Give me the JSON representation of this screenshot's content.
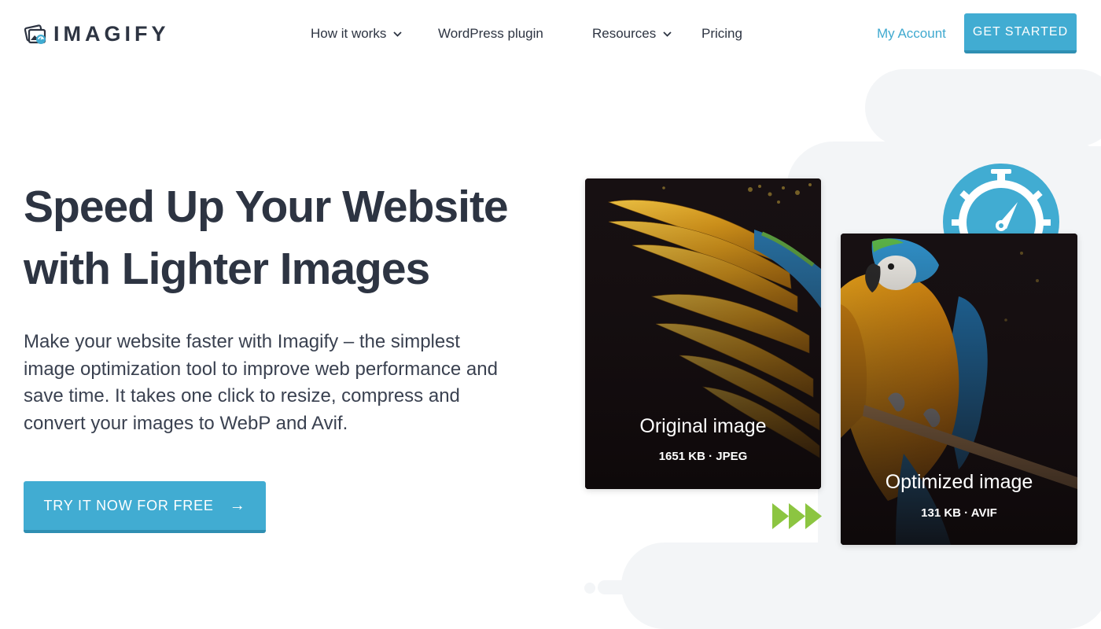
{
  "brand": {
    "name": "IMAGIFY"
  },
  "nav": {
    "items": [
      {
        "label": "How it works",
        "has_dropdown": true
      },
      {
        "label": "WordPress plugin",
        "has_dropdown": false
      },
      {
        "label": "Resources",
        "has_dropdown": true
      },
      {
        "label": "Pricing",
        "has_dropdown": false
      }
    ],
    "account_label": "My Account",
    "cta_label": "GET STARTED"
  },
  "hero": {
    "title_lines": [
      "Speed Up Your Website",
      "with Lighter Images"
    ],
    "description_lines": [
      "Make your website faster with Imagify – the simplest",
      "image optimization tool to improve web performance and",
      "save time. It takes one click to resize, compress and",
      "convert your images to WebP and Avif."
    ],
    "cta_label": "TRY IT NOW FOR FREE",
    "cta_icon": "arrow-right-icon"
  },
  "comparison": {
    "original": {
      "label": "Original image",
      "meta": "1651 KB · JPEG"
    },
    "optimized": {
      "label": "Optimized image",
      "meta": "131 KB · AVIF"
    }
  },
  "colors": {
    "accent": "#41acd2",
    "accent_dark": "#2f8fb2",
    "text": "#2d3442",
    "arrow_green": "#8cc541",
    "cloud": "#f3f5f7"
  }
}
